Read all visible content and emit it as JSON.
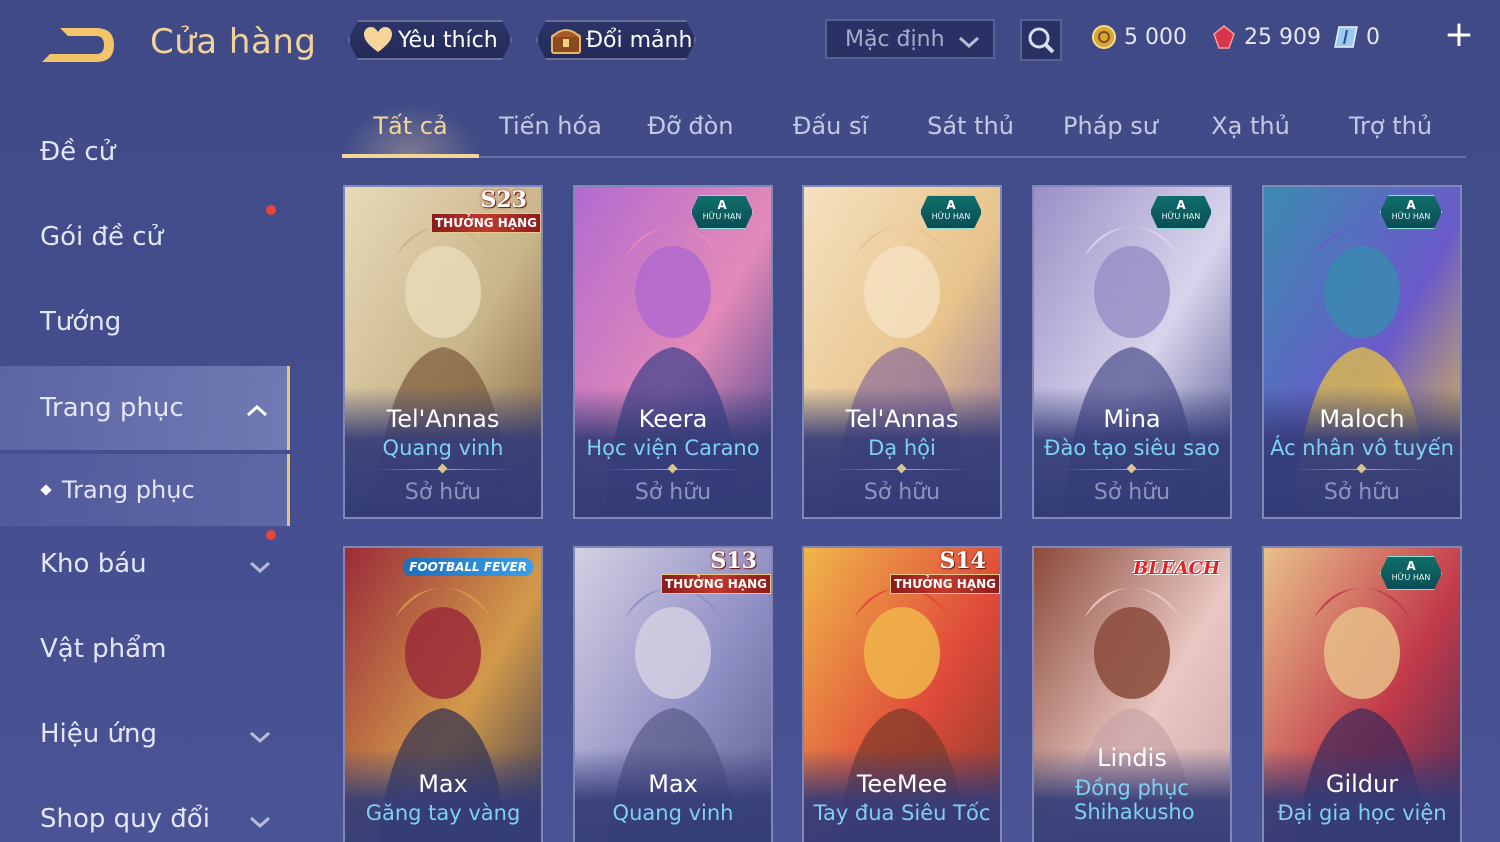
{
  "header": {
    "title": "Cửa hàng",
    "favorite_label": "Yêu thích",
    "shard_label": "Đổi mảnh",
    "sort_value": "Mặc định",
    "currencies": {
      "gold": "5 000",
      "gems": "25 909",
      "tickets": "0"
    },
    "plus_symbol": "+"
  },
  "sidebar": {
    "items": [
      {
        "label": "Đề cử"
      },
      {
        "label": "Gói đề cử"
      },
      {
        "label": "Tướng"
      },
      {
        "label": "Trang phục"
      },
      {
        "label": "Trang phục"
      },
      {
        "label": "Kho báu"
      },
      {
        "label": "Vật phẩm"
      },
      {
        "label": "Hiệu ứng"
      },
      {
        "label": "Shop quy đổi"
      }
    ]
  },
  "tabs": [
    {
      "label": "Tất cả"
    },
    {
      "label": "Tiến hóa"
    },
    {
      "label": "Đỡ đòn"
    },
    {
      "label": "Đấu sĩ"
    },
    {
      "label": "Sát thủ"
    },
    {
      "label": "Pháp sư"
    },
    {
      "label": "Xạ thủ"
    },
    {
      "label": "Trợ thủ"
    }
  ],
  "cards": [
    {
      "hero": "Tel'Annas",
      "skin": "Quang vinh",
      "status": "Sở hữu",
      "badge_type": "rank",
      "badge_title": "S23",
      "badge_label": "THƯỞNG HẠNG",
      "colors": [
        "#c9b58a",
        "#e8d9b8",
        "#7a5a3a"
      ]
    },
    {
      "hero": "Keera",
      "skin": "Học viện Carano",
      "status": "Sở hữu",
      "badge_type": "limited",
      "badge_title": "A",
      "badge_label": "HỮU HẠN",
      "colors": [
        "#e38ab8",
        "#b26ad0",
        "#3a3f8a"
      ]
    },
    {
      "hero": "Tel'Annas",
      "skin": "Dạ hội",
      "status": "Sở hữu",
      "badge_type": "limited",
      "badge_title": "A",
      "badge_label": "HỮU HẠN",
      "colors": [
        "#e8c48c",
        "#f5e1c0",
        "#8a6b9a"
      ]
    },
    {
      "hero": "Mina",
      "skin": "Đào tạo siêu sao",
      "status": "Sở hữu",
      "badge_type": "limited",
      "badge_title": "A",
      "badge_label": "HỮU HẠN",
      "colors": [
        "#d9d4ec",
        "#9a8fc6",
        "#4b4f8a"
      ]
    },
    {
      "hero": "Maloch",
      "skin": "Ác nhân vô tuyến",
      "status": "Sở hữu",
      "badge_type": "limited",
      "badge_title": "A",
      "badge_label": "HỮU HẠN",
      "colors": [
        "#6a5ac9",
        "#3b8ab0",
        "#f0c93a"
      ]
    },
    {
      "hero": "Max",
      "skin": "Găng tay vàng",
      "status": "",
      "badge_type": "text",
      "badge_title": "FOOTBALL FEVER",
      "badge_label": "",
      "colors": [
        "#d29a4a",
        "#9b2b3a",
        "#2d2f52"
      ]
    },
    {
      "hero": "Max",
      "skin": "Quang vinh",
      "status": "",
      "badge_type": "rank",
      "badge_title": "S13",
      "badge_label": "THƯỞNG HẠNG",
      "colors": [
        "#8f8ec4",
        "#d4cfe2",
        "#5a5a86"
      ]
    },
    {
      "hero": "TeeMee",
      "skin": "Tay đua Siêu Tốc",
      "status": "",
      "badge_type": "rank",
      "badge_title": "S14",
      "badge_label": "THƯỞNG HẠNG",
      "colors": [
        "#e04a3a",
        "#f0b64a",
        "#7a3a2a"
      ]
    },
    {
      "hero": "Lindis",
      "skin": "Đồng phục Shihakusho",
      "status": "",
      "badge_type": "bleach",
      "badge_title": "BLEACH",
      "badge_label": "",
      "colors": [
        "#e9c7c2",
        "#8a4a3a",
        "#c7a3a6"
      ]
    },
    {
      "hero": "Gildur",
      "skin": "Đại gia học viện",
      "status": "",
      "badge_type": "limited",
      "badge_title": "A",
      "badge_label": "HỮU HẠN",
      "colors": [
        "#c23a4a",
        "#e8c08a",
        "#3a2a5a"
      ]
    }
  ]
}
